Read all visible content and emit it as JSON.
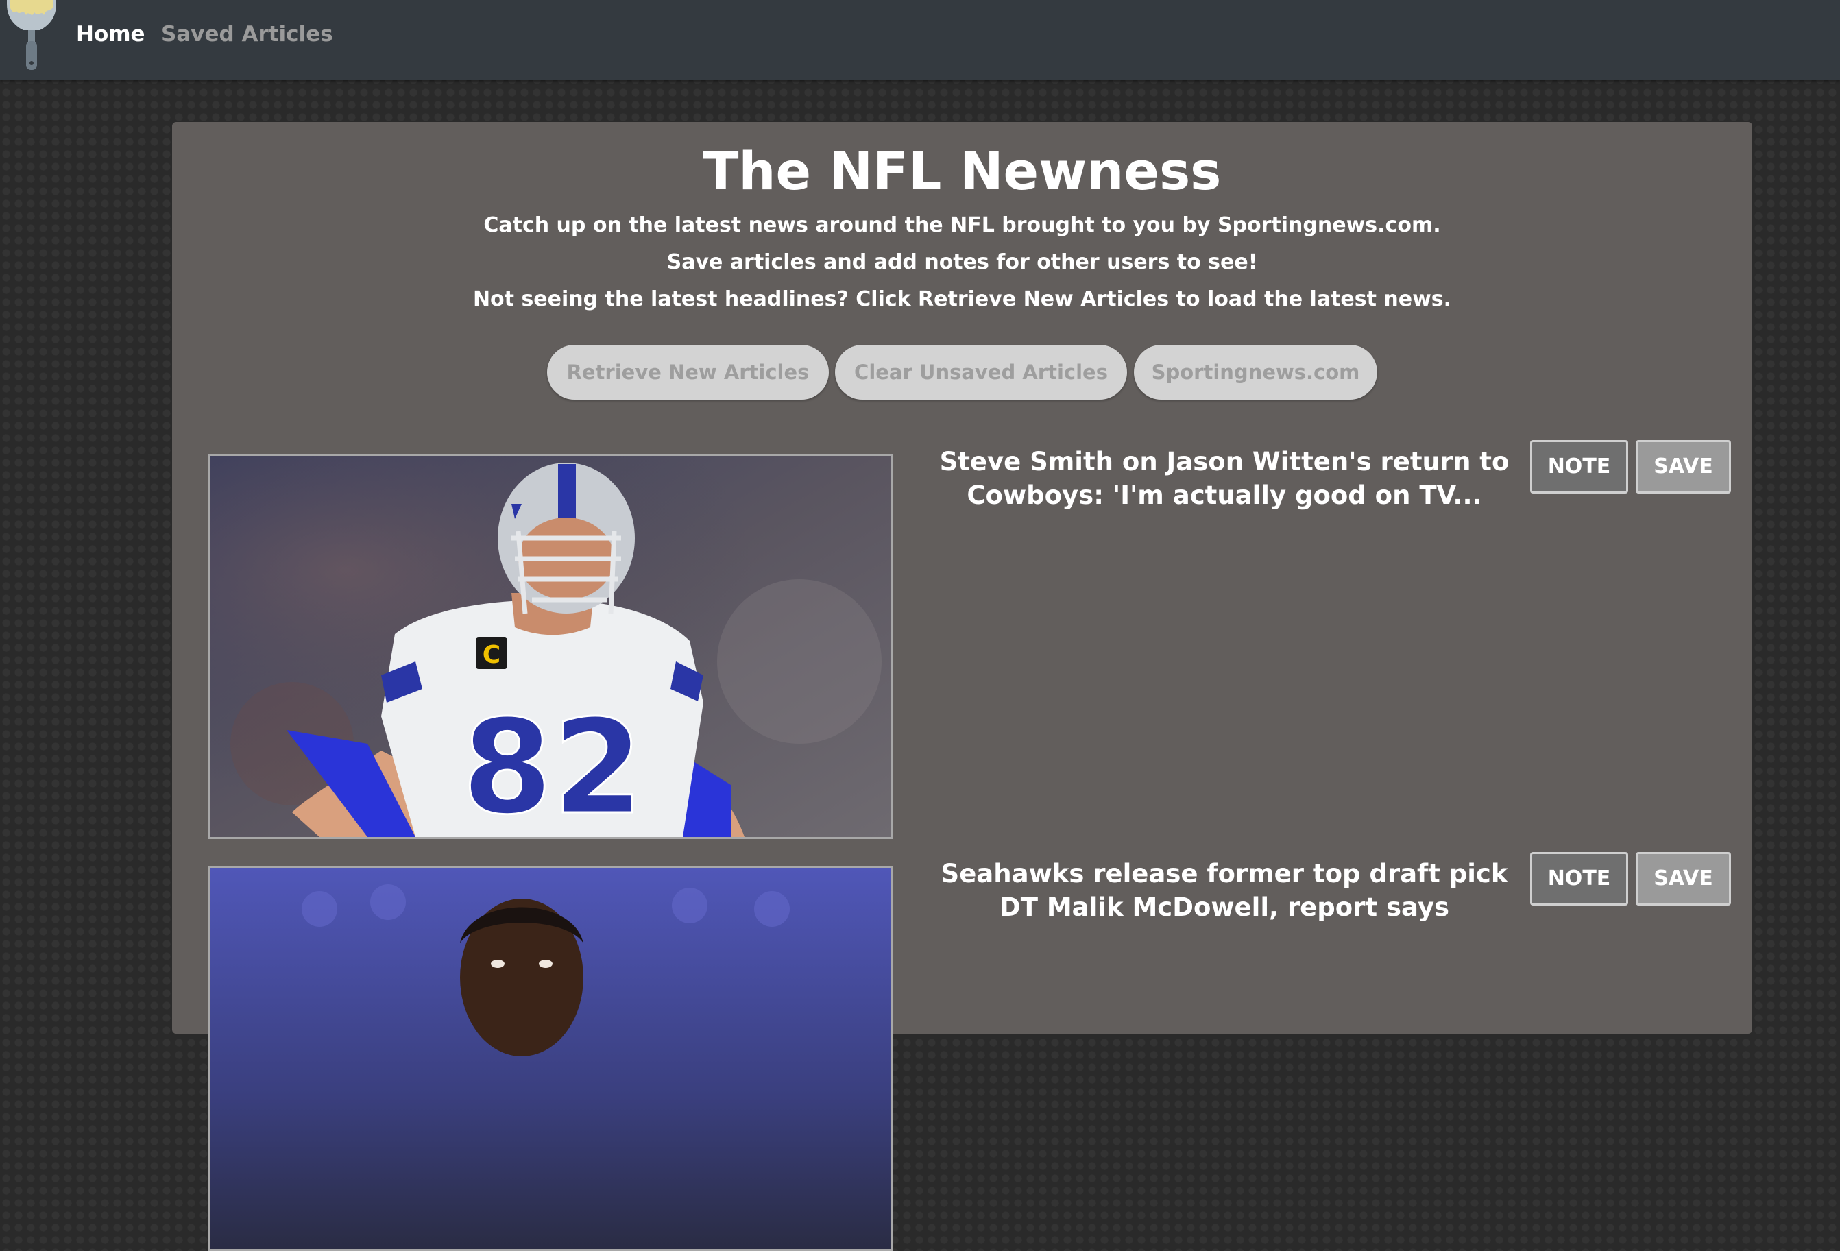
{
  "navbar": {
    "brand_icon": "scraper-icon",
    "links": [
      {
        "label": "Home",
        "active": true
      },
      {
        "label": "Saved Articles",
        "active": false
      }
    ]
  },
  "header": {
    "title": "The NFL Newness",
    "lines": [
      "Catch up on the latest news around the NFL brought to you by Sportingnews.com.",
      "Save articles and add notes for other users to see!",
      "Not seeing the latest headlines? Click Retrieve New Articles to load the latest news."
    ],
    "buttons": {
      "retrieve": "Retrieve New Articles",
      "clear": "Clear Unsaved Articles",
      "site": "Sportingnews.com"
    }
  },
  "articles": [
    {
      "headline": "Steve Smith on Jason Witten's return to Cowboys: 'I'm actually good on TV...",
      "note_label": "NOTE",
      "save_label": "SAVE",
      "image": {
        "subject": "football-player-photo",
        "jersey_number": "82",
        "captain_patch": "C"
      }
    },
    {
      "headline": "Seahawks release former top draft pick DT Malik McDowell, report says",
      "note_label": "NOTE",
      "save_label": "SAVE",
      "image": {
        "subject": "football-player-photo"
      }
    }
  ],
  "colors": {
    "navbar": "#343a40",
    "panel": "#625e5c",
    "pill_bg": "#d3d3d3",
    "pill_text": "#9e9e9e",
    "note_bg": "#6f6f6f",
    "save_bg": "#9a9a9a",
    "jersey_blue": "#2a36a6",
    "helmet_silver": "#c8ccd2"
  }
}
